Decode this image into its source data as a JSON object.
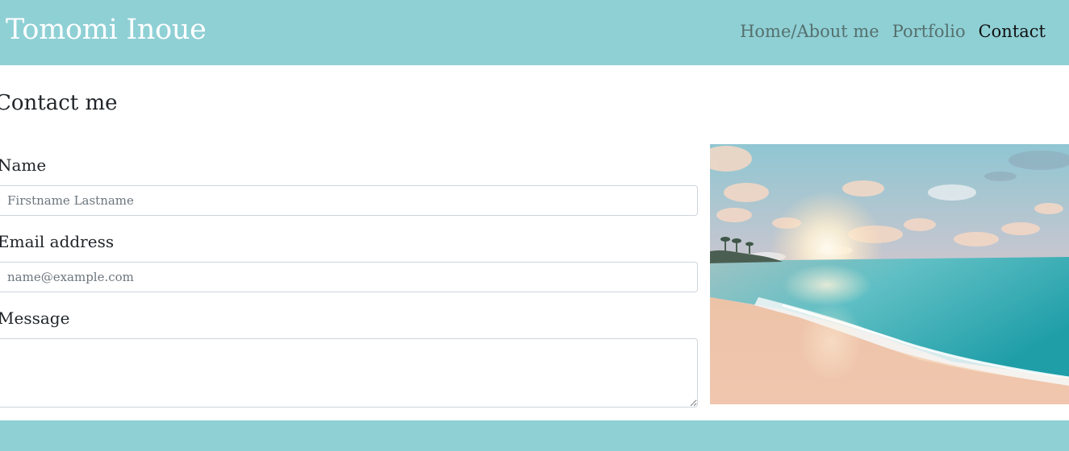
{
  "header": {
    "brand": "Tomomi Inoue",
    "nav": [
      {
        "label": "Home/About me",
        "active": false
      },
      {
        "label": "Portfolio",
        "active": false
      },
      {
        "label": "Contact",
        "active": true
      }
    ]
  },
  "main": {
    "title": "Contact me",
    "form": {
      "name_label": "Name",
      "name_placeholder": "Firstname Lastname",
      "name_value": "",
      "email_label": "Email address",
      "email_placeholder": "name@example.com",
      "email_value": "",
      "message_label": "Message",
      "message_value": ""
    },
    "image": {
      "subject": "beach-sunset-photo"
    }
  },
  "colors": {
    "header_bg": "#8fd0d5",
    "footer_bg": "#8fd0d5",
    "brand_text": "#ffffff",
    "nav_text": "#55706e",
    "nav_active_text": "#111111"
  }
}
